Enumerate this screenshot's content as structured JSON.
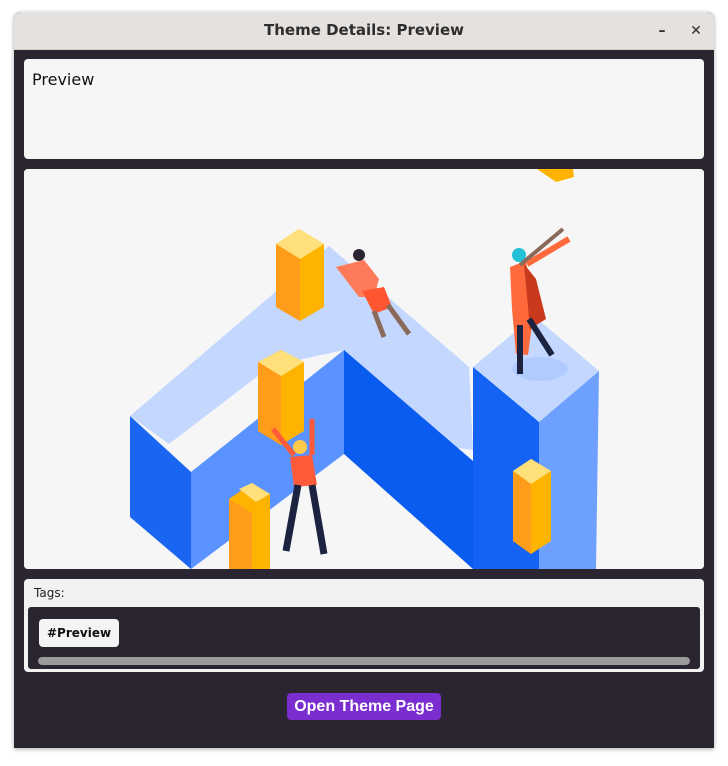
{
  "window": {
    "title": "Theme Details: Preview"
  },
  "controls": {
    "minimize_icon": "minimize-icon",
    "close_icon": "close-icon"
  },
  "preview": {
    "label": "Preview"
  },
  "illustration": {
    "description_icon": "isometric-illustration"
  },
  "tags": {
    "label": "Tags:",
    "items": [
      "#Preview"
    ]
  },
  "actions": {
    "open_theme_page": "Open Theme Page"
  },
  "colors": {
    "accent": "#7b2ecf",
    "background": "#2b2531",
    "panel": "#f6f6f6"
  }
}
